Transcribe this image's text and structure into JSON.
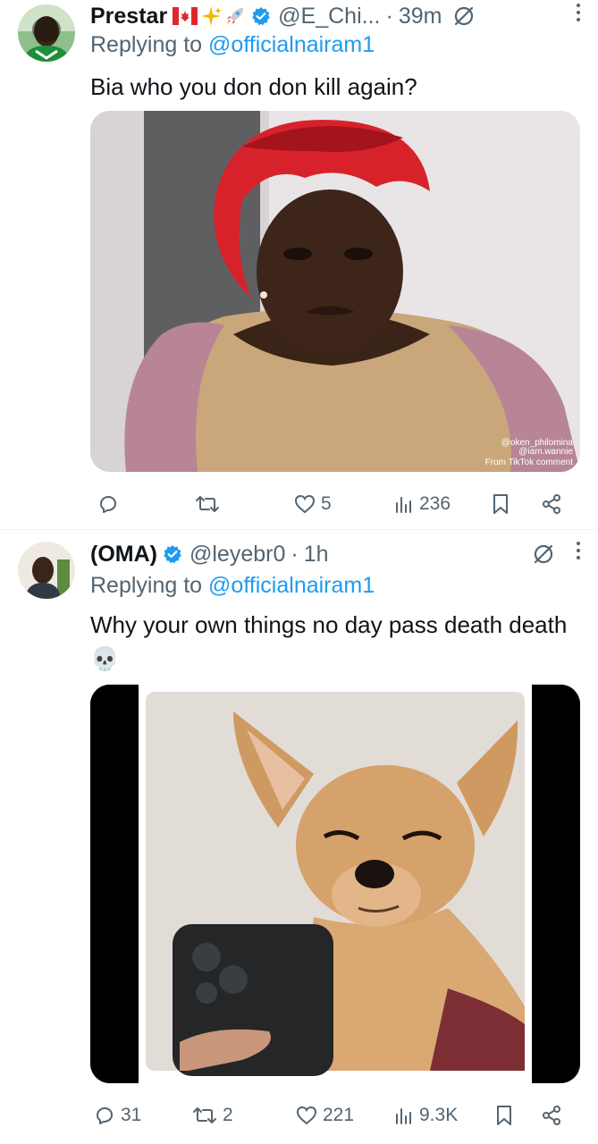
{
  "tweets": [
    {
      "author_name": "Prestar",
      "handle": "@E_Chi...",
      "separator": "·",
      "time": "39m",
      "replying_prefix": "Replying to ",
      "replying_to": "@officialnairam1",
      "text": "Bia who you don don kill again?",
      "media_watermark_1": "@oken_philomina",
      "media_watermark_2": "@iam.wannie",
      "media_watermark_3": "From TikTok comment",
      "stats": {
        "replies": "",
        "reposts": "",
        "likes": "5",
        "views": "236"
      }
    },
    {
      "author_name": "(OMA)",
      "handle": "@leyebr0",
      "separator": "·",
      "time": "1h",
      "replying_prefix": "Replying to ",
      "replying_to": "@officialnairam1",
      "text": "Why your own things no day pass death death 💀",
      "stats": {
        "replies": "31",
        "reposts": "2",
        "likes": "221",
        "views": "9.3K"
      }
    }
  ],
  "colors": {
    "accent": "#1d9bf0",
    "secondary_text": "#536471",
    "verified": "#1d9bf0"
  }
}
